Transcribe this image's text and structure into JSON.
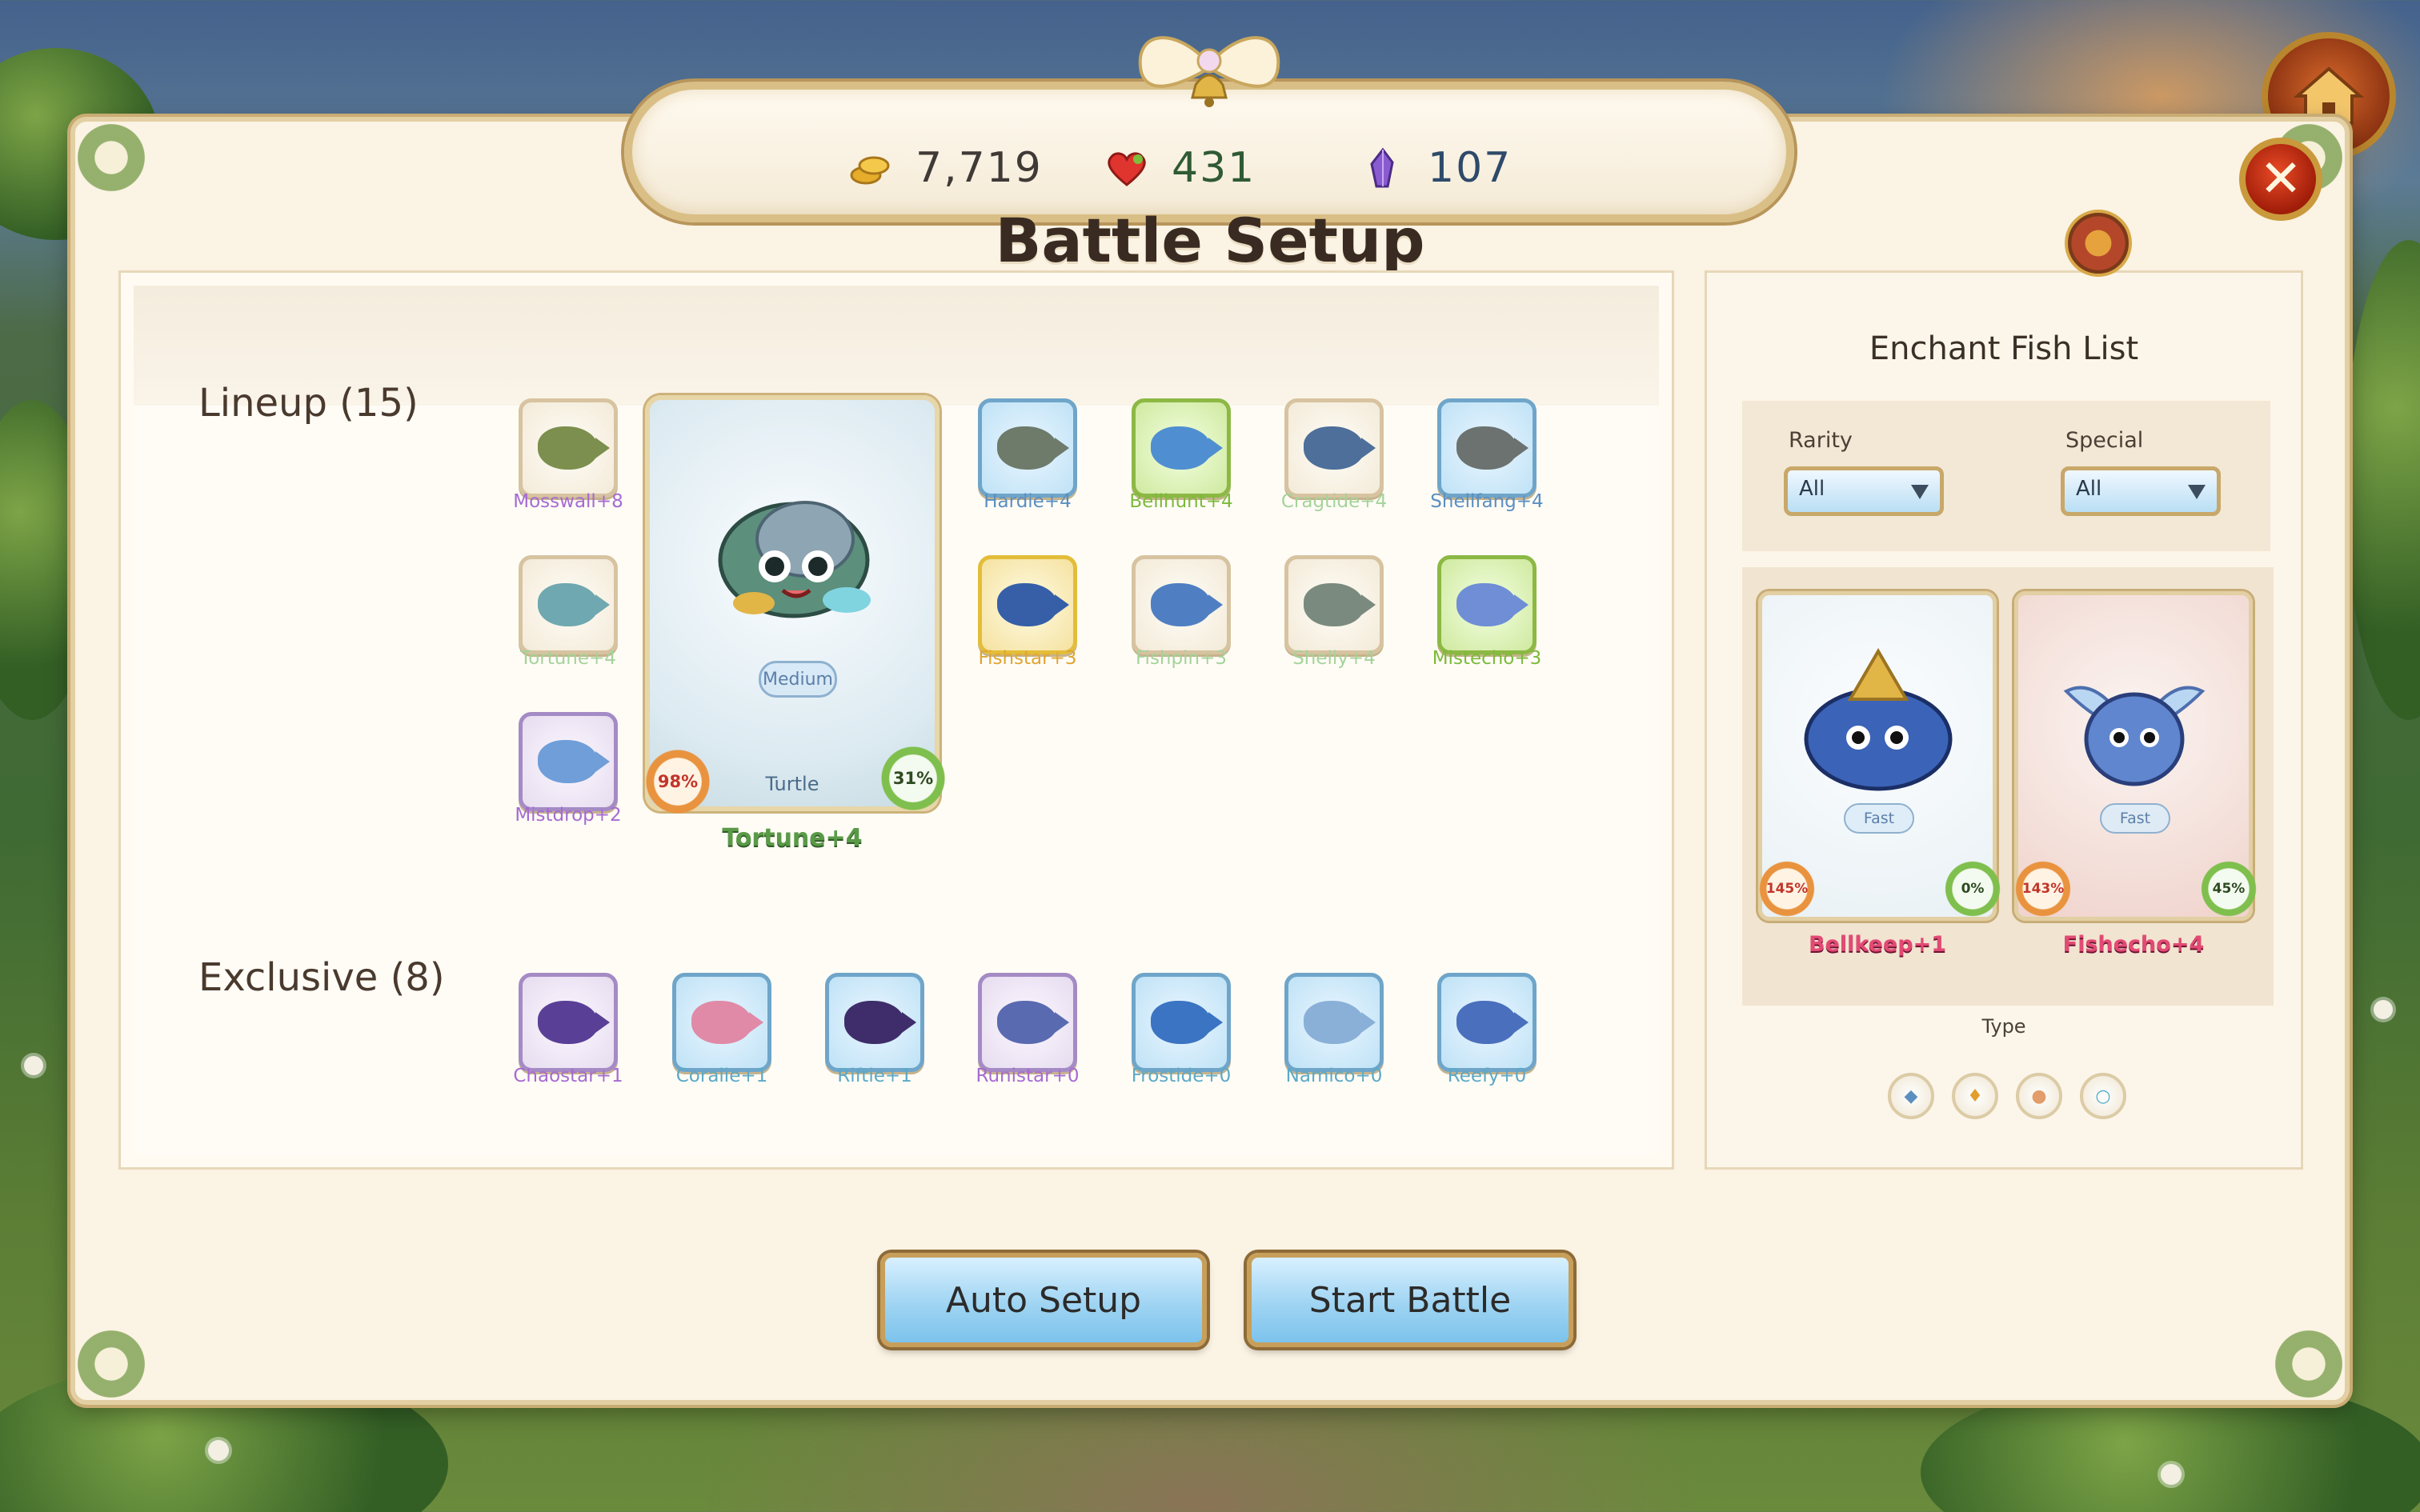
{
  "header": {
    "coins": "7,719",
    "hearts": "431",
    "gems": "107",
    "title": "Battle Setup"
  },
  "icons": {
    "coins": "coin-icon",
    "hearts": "heart-icon",
    "gems": "crystal-icon",
    "home": "home-icon",
    "close": "close-icon",
    "close_glyph": "✕",
    "badge": "medal-icon"
  },
  "lineup": {
    "label": "Lineup (15)",
    "items": [
      {
        "name": "Mosswall+8",
        "color": "#a56bd2",
        "frame": "cream",
        "fish": "#7c8f4e"
      },
      {
        "name": "Tortune+4",
        "color": "#a5d39a",
        "frame": "cream",
        "fish": "#6fa8b0"
      },
      {
        "name": "Mistdrop+2",
        "color": "#a56bd2",
        "frame": "purple",
        "fish": "#6f9ed9"
      },
      {
        "name": "Hardie+4",
        "color": "#5b8fc0",
        "frame": "blue",
        "fish": "#6e7a6a"
      },
      {
        "name": "Bellhunt+4",
        "color": "#7cba3a",
        "frame": "green",
        "fish": "#4f8fd1"
      },
      {
        "name": "Cragtide+4",
        "color": "#a5d39a",
        "frame": "cream",
        "fish": "#4d6f9a"
      },
      {
        "name": "Shellfang+4",
        "color": "#5b8fc0",
        "frame": "blue",
        "fish": "#6b7270"
      },
      {
        "name": "Fishstar+3",
        "color": "#e0a531",
        "frame": "gold",
        "fish": "#365fa8"
      },
      {
        "name": "Fishpin+3",
        "color": "#a5d39a",
        "frame": "cream",
        "fish": "#4f7fc2"
      },
      {
        "name": "Shelly+4",
        "color": "#a5d39a",
        "frame": "cream",
        "fish": "#7a8a7e"
      },
      {
        "name": "Mistecho+3",
        "color": "#7cba3a",
        "frame": "green",
        "fish": "#6f8ed6"
      }
    ],
    "featured": {
      "name": "Tortune+4",
      "speed": "Medium",
      "type": "Turtle",
      "left_pct": "98%",
      "right_pct": "31%"
    }
  },
  "exclusive": {
    "label": "Exclusive (8)",
    "items": [
      {
        "name": "Chaostar+1",
        "color": "#a56bd2",
        "frame": "purple",
        "fish": "#5a3f96"
      },
      {
        "name": "Coralie+1",
        "color": "#5ba9c6",
        "frame": "blue",
        "fish": "#e08aa8"
      },
      {
        "name": "Riftie+1",
        "color": "#5ba9c6",
        "frame": "blue",
        "fish": "#3e2d6a"
      },
      {
        "name": "Runistar+0",
        "color": "#a56bd2",
        "frame": "purple",
        "fish": "#5a6ab0"
      },
      {
        "name": "Frostide+0",
        "color": "#5ba9c6",
        "frame": "blue",
        "fish": "#3a74c2"
      },
      {
        "name": "Namico+0",
        "color": "#5ba9c6",
        "frame": "blue",
        "fish": "#8ab0d8"
      },
      {
        "name": "Reefy+0",
        "color": "#5ba9c6",
        "frame": "blue",
        "fish": "#4a6fbd"
      }
    ]
  },
  "enchant": {
    "title": "Enchant Fish List",
    "rarity_label": "Rarity",
    "rarity_value": "All",
    "special_label": "Special",
    "special_value": "All",
    "fish": [
      {
        "name": "Bellkeep+1",
        "speed": "Fast",
        "left_pct": "145%",
        "right_pct": "0%",
        "bg": "#e9f1f4",
        "body": "#3b63b8"
      },
      {
        "name": "Fishecho+4",
        "speed": "Fast",
        "left_pct": "143%",
        "right_pct": "45%",
        "bg": "#f0d3cc",
        "body": "#5f86cf"
      }
    ],
    "type_label": "Type",
    "type_icons": [
      "water-drop-icon",
      "flame-icon",
      "shell-icon",
      "bubble-icon"
    ]
  },
  "buttons": {
    "auto_setup": "Auto Setup",
    "start_battle": "Start Battle"
  },
  "colors": {
    "panel_bg": "#fbf3e3",
    "gold_frame": "#d9bf86",
    "close_red": "#c92a10",
    "button_blue": "#9fd4f2"
  }
}
